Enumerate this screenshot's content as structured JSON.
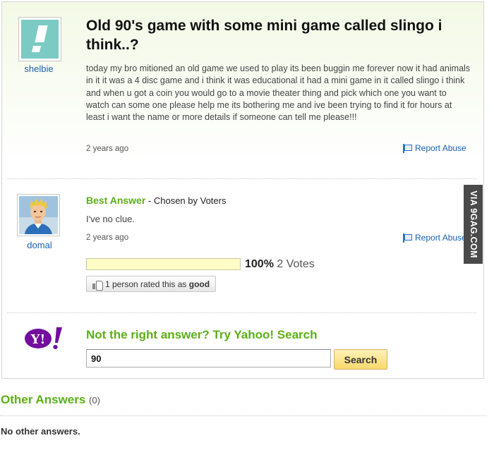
{
  "question": {
    "username": "shelbie",
    "title": "Old 90's game with some mini game called slingo i think..?",
    "body": "today my bro mitioned an old game we used to play its been buggin me forever now it had animals in it it was a 4 disc game and i think it was educational it had a mini game in it called slingo i think and when u got a coin you would go to a movie theater thing and pick which one you want to watch can some one please help me its bothering me and ive been trying to find it for hours at least i want the name or more details if someone can tell me please!!!",
    "time": "2 years ago",
    "report_label": "Report Abuse",
    "avatar_icon": "exclamation-avatar-icon"
  },
  "best_answer": {
    "username": "domal",
    "label": "Best Answer",
    "chosen_by": " - Chosen by Voters",
    "text": "I've no clue.",
    "time": "2 years ago",
    "report_label": "Report Abuse",
    "vote_fraction": 1.0,
    "vote_percent": "100%",
    "votes_label": "2 Votes",
    "rated_prefix": "1 person rated this as ",
    "rated_value": "good"
  },
  "yahoo_search": {
    "logo_text": "Y!",
    "title": "Not the right answer? Try Yahoo! Search",
    "input_value": "90",
    "button_label": "Search"
  },
  "watermark": "VIA 9GAG.COM",
  "other_answers": {
    "title": "Other Answers",
    "count": "(0)",
    "empty_text": "No other answers."
  },
  "colors": {
    "accent_green": "#5cb015",
    "link_blue": "#1a5fb4",
    "yahoo_purple": "#720e9e",
    "vote_bar": "#fcfcc4",
    "search_button": "#f9d86c"
  }
}
